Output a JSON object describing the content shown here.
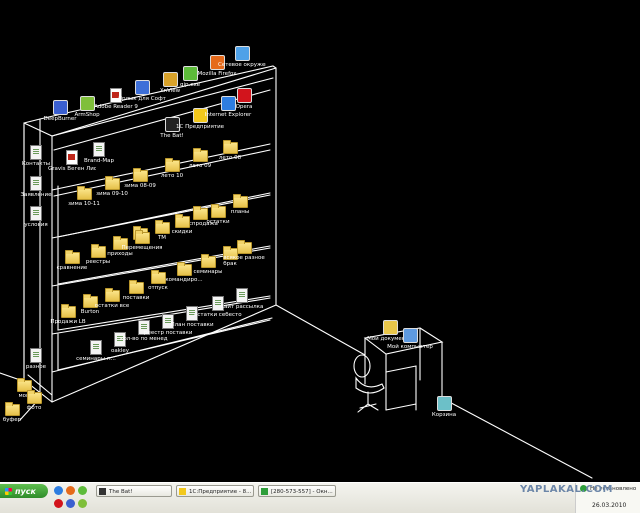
{
  "desktop": {
    "wallpaper": "black background with white line-drawing of a bookshelf, desk and chair",
    "shelf_icons": [
      {
        "id": "deepburner",
        "label": "DeepBurner",
        "kind": "app",
        "color": "#3a5fd0"
      },
      {
        "id": "amshop",
        "label": "ArmShop",
        "kind": "app",
        "color": "#7fbf3a"
      },
      {
        "id": "adobe",
        "label": "Adobe Reader 9",
        "kind": "pdf",
        "color": "#c0281c"
      },
      {
        "id": "yarlyk",
        "label": "Ярлык для Софт",
        "kind": "app",
        "color": "#3d6fd8"
      },
      {
        "id": "xnview",
        "label": "XnView",
        "kind": "app",
        "color": "#d8a22a"
      },
      {
        "id": "qip",
        "label": "qip.exe",
        "kind": "app",
        "color": "#5dbb3a"
      },
      {
        "id": "firefox",
        "label": "Mozilla Firefox",
        "kind": "app",
        "color": "#e56a1b"
      },
      {
        "id": "network",
        "label": "Сетевое окружение",
        "kind": "app",
        "color": "#4ea1e8"
      },
      {
        "id": "thebat",
        "label": "The Bat!",
        "kind": "app",
        "color": "#222"
      },
      {
        "id": "1c",
        "label": "1С Предприятие",
        "kind": "app",
        "color": "#f2c81c"
      },
      {
        "id": "ie",
        "label": "Internet Explorer",
        "kind": "app",
        "color": "#2d7de0"
      },
      {
        "id": "opera",
        "label": "Opera",
        "kind": "app",
        "color": "#d2141c"
      },
      {
        "id": "contacts",
        "label": "Контакты",
        "kind": "doc"
      },
      {
        "id": "zayavl",
        "label": "Заявление",
        "kind": "doc"
      },
      {
        "id": "usloviya",
        "label": "условия",
        "kind": "doc"
      },
      {
        "id": "gravis",
        "label": "Gravis Веген Лист-2011",
        "kind": "pdf"
      },
      {
        "id": "brandmap",
        "label": "Brand-Мар",
        "kind": "doc"
      },
      {
        "id": "leto10",
        "label": "лето 10",
        "kind": "folder"
      },
      {
        "id": "leto09",
        "label": "лето 09",
        "kind": "folder"
      },
      {
        "id": "leto08",
        "label": "лето 08",
        "kind": "folder"
      },
      {
        "id": "zima0809",
        "label": "зима 08-09",
        "kind": "folder"
      },
      {
        "id": "zima0910",
        "label": "зима 09-10",
        "kind": "folder"
      },
      {
        "id": "zima1011",
        "label": "зима 10-11",
        "kind": "folder"
      },
      {
        "id": "f_row3_1",
        "label": "",
        "kind": "folder"
      },
      {
        "id": "tm",
        "label": "ТМ",
        "kind": "folder"
      },
      {
        "id": "raspr",
        "label": "Распродажа",
        "kind": "folder"
      },
      {
        "id": "skidki",
        "label": "скидки",
        "kind": "folder"
      },
      {
        "id": "ostatki",
        "label": "остатки",
        "kind": "folder"
      },
      {
        "id": "plany",
        "label": "планы",
        "kind": "folder"
      },
      {
        "id": "sravnenie",
        "label": "сравнение",
        "kind": "folder"
      },
      {
        "id": "reestry",
        "label": "реестры",
        "kind": "folder"
      },
      {
        "id": "prikhod",
        "label": "приходы",
        "kind": "folder"
      },
      {
        "id": "peremeshch",
        "label": "Перемещения",
        "kind": "folder"
      },
      {
        "id": "otpusk",
        "label": "отпуск",
        "kind": "folder"
      },
      {
        "id": "komandir",
        "label": "командиро...",
        "kind": "folder"
      },
      {
        "id": "seminary",
        "label": "семинары",
        "kind": "folder"
      },
      {
        "id": "brak",
        "label": "брак",
        "kind": "folder"
      },
      {
        "id": "vsyakoe",
        "label": "всякое разное",
        "kind": "folder"
      },
      {
        "id": "prodazhi",
        "label": "Продажи LB",
        "kind": "folder"
      },
      {
        "id": "burton",
        "label": "Burton",
        "kind": "folder"
      },
      {
        "id": "ostatki_vse",
        "label": "остатки все",
        "kind": "folder"
      },
      {
        "id": "postavki",
        "label": "поставки",
        "kind": "folder"
      },
      {
        "id": "seminary_p",
        "label": "семинары-п...",
        "kind": "doc"
      },
      {
        "id": "oakley",
        "label": "oakley",
        "kind": "doc"
      },
      {
        "id": "kolvo",
        "label": "кол-во по менеджерам",
        "kind": "doc"
      },
      {
        "id": "reestr_post",
        "label": "реестр поставки",
        "kind": "doc"
      },
      {
        "id": "plan_post",
        "label": "План поставки",
        "kind": "doc"
      },
      {
        "id": "ostatki_seb",
        "label": "остатки себестоим",
        "kind": "doc"
      },
      {
        "id": "kayt",
        "label": "кайт рассылка",
        "kind": "doc"
      },
      {
        "id": "raznoe",
        "label": "разное",
        "kind": "doc"
      }
    ],
    "floor_icons": [
      {
        "id": "moi",
        "label": "мой",
        "kind": "folder"
      },
      {
        "id": "foto",
        "label": "фото",
        "kind": "folder"
      },
      {
        "id": "bufer",
        "label": "буфер",
        "kind": "folder"
      },
      {
        "id": "mydocs",
        "label": "Мои документы",
        "kind": "app",
        "color": "#e8c64a"
      },
      {
        "id": "mycomp",
        "label": "Мой компьютер",
        "kind": "app",
        "color": "#5e9ae0"
      },
      {
        "id": "recycle",
        "label": "Корзина",
        "kind": "app",
        "color": "#6cc0c8"
      }
    ]
  },
  "taskbar": {
    "start_label": "пуск",
    "tasks": [
      {
        "label": "The Bat!",
        "color": "#333"
      },
      {
        "label": "1С:Предприятие - 8...",
        "color": "#f2c81c"
      },
      {
        "label": "[280-573-557] - Окн...",
        "color": "#2e9e3a"
      }
    ],
    "tray_text": "Не установлено",
    "clock_date": "26.03.2010",
    "watermark": "YAPLAKAL.COM"
  }
}
